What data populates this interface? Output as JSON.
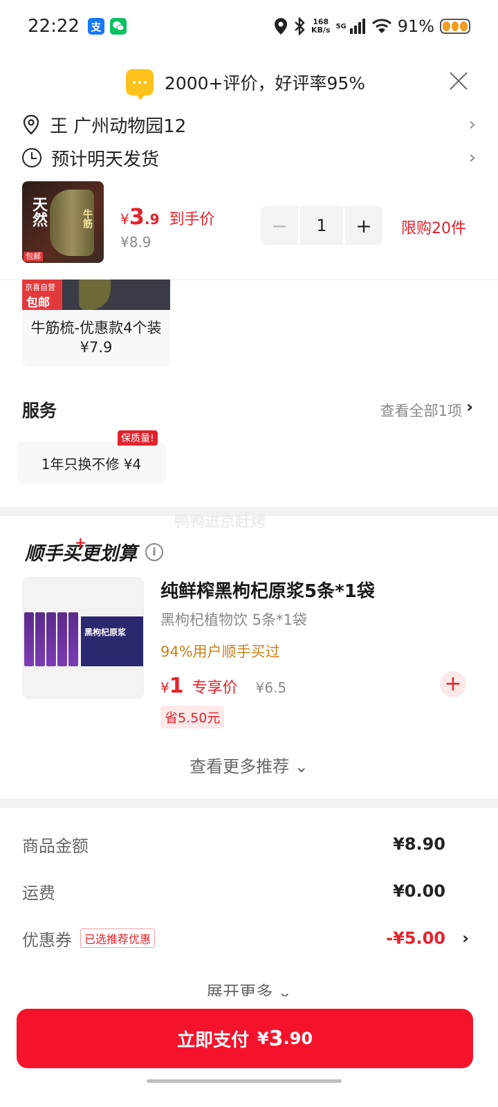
{
  "status": {
    "time": "22:22",
    "alipay_glyph": "支",
    "net_speed_value": "168",
    "net_speed_unit": "KB/s",
    "network": "5G",
    "battery": "91%"
  },
  "rating": {
    "text": "2000+评价，好评率95%"
  },
  "address": {
    "text": "王  广州动物园12"
  },
  "delivery": {
    "text": "预计明天发货"
  },
  "product": {
    "thumb_text": "天然",
    "thumb_text2": "牛筋",
    "thumb_tag": "包邮",
    "price_currency": "¥",
    "price_int": "3",
    "price_dec": ".9",
    "price_label": "到手价",
    "original_price": "¥8.9",
    "quantity": "1",
    "limit_text": "限购20件"
  },
  "variant": {
    "badge_top": "京喜自营",
    "badge_main": "包邮",
    "name": "牛筋梳-优惠款4个装 ¥7.9"
  },
  "services": {
    "title": "服务",
    "see_all": "查看全部1项",
    "item": "1年只换不修  ¥4",
    "badge": "保质量!"
  },
  "watermark": "鸭鸭进京赶烤",
  "bonus": {
    "title": "顺手买更划算",
    "item": {
      "name": "纯鲜榨黑枸杞原浆5条*1袋",
      "spec": "黑枸杞植物饮 5条*1袋",
      "bought": "94%用户顺手买过",
      "price_currency": "¥",
      "price": "1",
      "price_label": "专享价",
      "original_price": "¥6.5",
      "save": "省5.50元",
      "box_label": "黑枸杞原浆"
    },
    "see_more": "查看更多推荐 ⌄"
  },
  "fees": {
    "goods_label": "商品金额",
    "goods_value": "¥8.90",
    "shipping_label": "运费",
    "shipping_value": "¥0.00",
    "coupon_label": "优惠券",
    "coupon_tag": "已选推荐优惠",
    "coupon_value": "-¥5.00",
    "expand": "展开更多 ⌄"
  },
  "pay": {
    "label": "立即支付",
    "currency": "¥",
    "amount_int": "3",
    "amount_dec": ".90"
  },
  "colors": {
    "accent_red": "#e5222b",
    "pay_button": "#f5132b",
    "rating_icon": "#ffc21a",
    "bought_text": "#c9821b"
  },
  "icons": [
    "location-pin-icon",
    "clock-icon",
    "chevron-right-icon",
    "close-icon",
    "info-icon",
    "plus-icon",
    "message-bubble-icon"
  ]
}
